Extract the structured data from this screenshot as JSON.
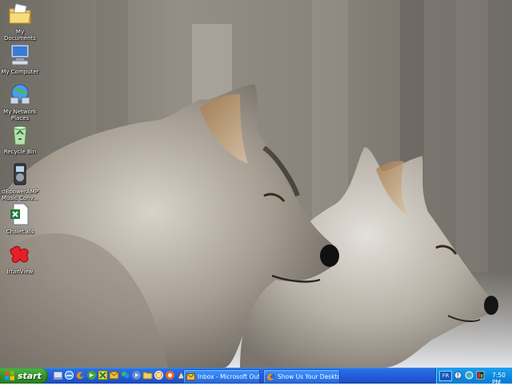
{
  "desktop": {
    "icons": [
      {
        "label": "My Documents",
        "icon": "folder-documents-icon"
      },
      {
        "label": "My Computer",
        "icon": "computer-icon"
      },
      {
        "label": "My Network Places",
        "icon": "network-places-icon"
      },
      {
        "label": "Recycle Bin",
        "icon": "recycle-bin-icon"
      },
      {
        "label": "dBpowerAMP Music Conv...",
        "icon": "music-converter-icon"
      },
      {
        "label": "Chalet.xls",
        "icon": "excel-file-icon"
      },
      {
        "label": "IrfanView",
        "icon": "irfanview-icon"
      }
    ]
  },
  "taskbar": {
    "start_label": "start",
    "quick_launch": [
      "show-desktop-icon",
      "ie-icon",
      "firefox-icon",
      "winamp-icon",
      "excel-icon",
      "outlook-icon",
      "messenger-icon",
      "mediaplayer-icon",
      "folder-icon",
      "ie2-icon",
      "firefox2-icon",
      "misc-icon"
    ],
    "tasks": [
      {
        "label": "Inbox - Microsoft Out...",
        "icon": "outlook-icon"
      },
      {
        "label": "Show Us Your Deskto...",
        "icon": "firefox-icon"
      }
    ],
    "tray": {
      "language": "FR",
      "clock": "7:50 PM",
      "icons": [
        "help-icon",
        "network-icon",
        "app-icon"
      ]
    }
  },
  "colors": {
    "taskbar_blue": "#245edb",
    "start_green": "#3c9b35",
    "tray_blue": "#0f8ae3"
  }
}
